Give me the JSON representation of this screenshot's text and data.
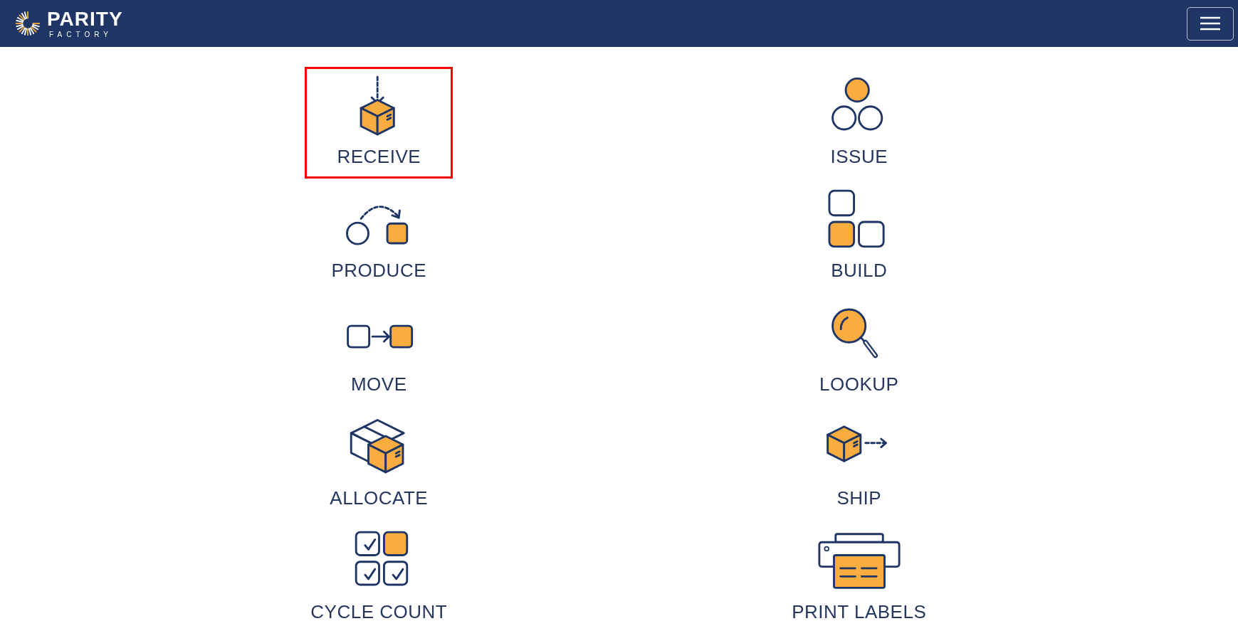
{
  "header": {
    "logo_title": "PARITY",
    "logo_subtitle": "FACTORY"
  },
  "tiles": [
    {
      "label": "RECEIVE",
      "selected": true
    },
    {
      "label": "ISSUE",
      "selected": false
    },
    {
      "label": "PRODUCE",
      "selected": false
    },
    {
      "label": "BUILD",
      "selected": false
    },
    {
      "label": "MOVE",
      "selected": false
    },
    {
      "label": "LOOKUP",
      "selected": false
    },
    {
      "label": "ALLOCATE",
      "selected": false
    },
    {
      "label": "SHIP",
      "selected": false
    },
    {
      "label": "CYCLE COUNT",
      "selected": false
    },
    {
      "label": "PRINT LABELS",
      "selected": false
    }
  ]
}
